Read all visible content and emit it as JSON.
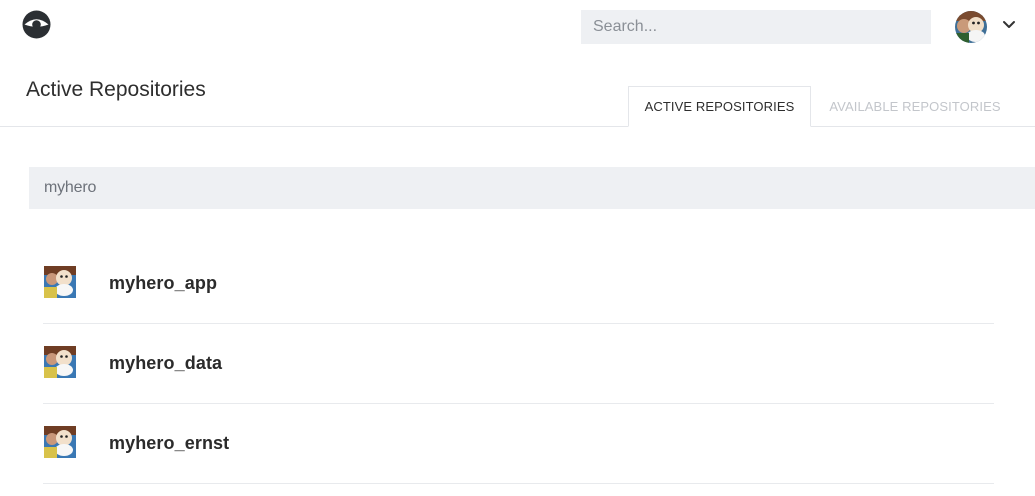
{
  "header": {
    "logo_icon": "drone-logo-icon",
    "search_placeholder": "Search...",
    "user_avatar_icon": "user-avatar-icon",
    "menu_icon": "chevron-down-icon"
  },
  "page": {
    "title": "Active Repositories"
  },
  "tabs": [
    {
      "label": "ACTIVE REPOSITORIES",
      "active": true
    },
    {
      "label": "AVAILABLE REPOSITORIES",
      "active": false
    }
  ],
  "filter": {
    "value": "myhero"
  },
  "repositories": [
    {
      "name": "myhero_app",
      "avatar_icon": "repo-avatar-icon"
    },
    {
      "name": "myhero_data",
      "avatar_icon": "repo-avatar-icon"
    },
    {
      "name": "myhero_ernst",
      "avatar_icon": "repo-avatar-icon"
    }
  ],
  "colors": {
    "input_bg": "#eef0f3",
    "divider": "#e4e6ea",
    "inactive_tab_text": "#c3c6cb",
    "text_dark": "#2e2e2e"
  }
}
